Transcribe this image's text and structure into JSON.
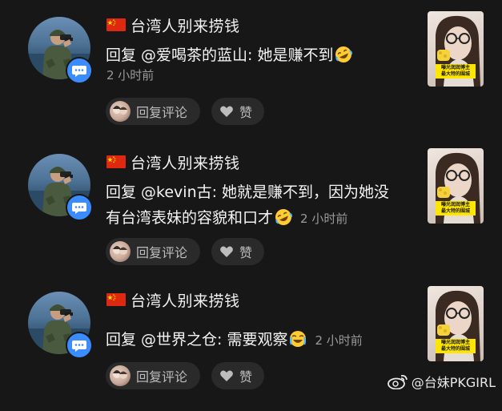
{
  "comments": [
    {
      "user": "台湾人别来捞钱",
      "text": "回复 @爱喝茶的蓝山: 她是赚不到",
      "emoji": "rolling-on-floor-laughing",
      "time": "2 小时前",
      "reply_label": "回复评论",
      "like_label": "赞",
      "thumb_caption": [
        "曝光润润博主",
        "最大特的围城"
      ]
    },
    {
      "user": "台湾人别来捞钱",
      "text_line1": "回复 @kevin古: 她就是赚不到，因为她没",
      "text_line2": "有台湾表妹的容貌和口才",
      "emoji": "rolling-on-floor-laughing",
      "time": "2 小时前",
      "reply_label": "回复评论",
      "like_label": "赞",
      "thumb_caption": [
        "曝光润润博主",
        "最大特的围城"
      ]
    },
    {
      "user": "台湾人别来捞钱",
      "text": "回复 @世界之仓: 需要观察",
      "emoji": "loudly-laughing-crying",
      "time": "2 小时前",
      "reply_label": "回复评论",
      "like_label": "赞",
      "thumb_caption": [
        "曝光润润博主",
        "最大特的围城"
      ]
    }
  ],
  "watermark": "@台妹PKGIRL",
  "colors": {
    "background": "#171717",
    "button_bg": "#2a2a2a",
    "badge_blue": "#3b8cff",
    "flag_red": "#de2910",
    "time_gray": "#9a9a9a"
  }
}
